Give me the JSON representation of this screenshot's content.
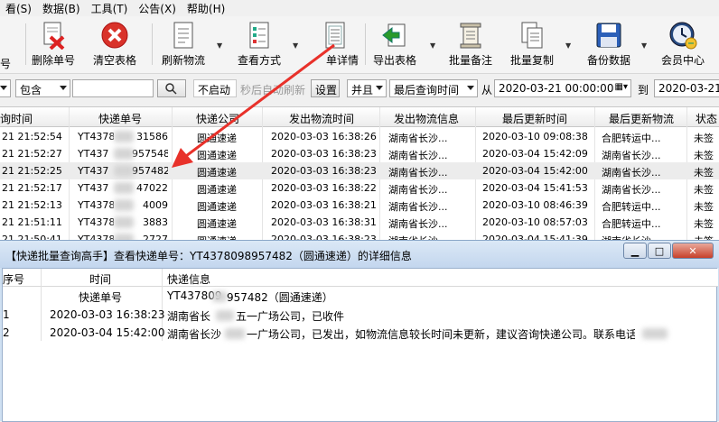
{
  "menu": [
    "看(S)",
    "数据(B)",
    "工具(T)",
    "公告(X)",
    "帮助(H)"
  ],
  "toolbar": {
    "partial_label": "号",
    "buttons": [
      {
        "label": "删除单号",
        "icon": "delete-doc-icon"
      },
      {
        "label": "清空表格",
        "icon": "clear-red-x-icon"
      },
      {
        "label": "刷新物流",
        "icon": "refresh-doc-icon"
      },
      {
        "label": "查看方式",
        "icon": "view-list-icon"
      },
      {
        "label": "单详情",
        "icon": "detail-doc-icon"
      },
      {
        "label": "导出表格",
        "icon": "export-green-arrow-icon"
      },
      {
        "label": "批量备注",
        "icon": "note-scroll-icon"
      },
      {
        "label": "批量复制",
        "icon": "copy-doc-icon"
      },
      {
        "label": "备份数据",
        "icon": "floppy-disk-icon"
      },
      {
        "label": "会员中心",
        "icon": "clock-user-icon"
      }
    ]
  },
  "filter": {
    "contains": "包含",
    "status_button": "不启动",
    "auto_refresh_text": "秒后自动刷新",
    "settings_button": "设置",
    "logic": "并且",
    "time_field": "最后查询时间",
    "from_label": "从",
    "from_value": "2020-03-21 00:00:00",
    "to_label": "到",
    "to_value": "2020-03-21 ..."
  },
  "table": {
    "headers": [
      "询时间",
      "快递单号",
      "快递公司",
      "发出物流时间",
      "发出物流信息",
      "最后更新时间",
      "最后更新物流",
      "状态"
    ],
    "rows": [
      [
        "21 21:52:54",
        "YT43780",
        "31586",
        "圆通速递",
        "2020-03-03 16:38:26",
        "湖南省长沙...",
        "2020-03-10 09:08:38",
        "合肥转运中...",
        "未签"
      ],
      [
        "21 21:52:27",
        "YT437",
        "957548",
        "圆通速递",
        "2020-03-03 16:38:23",
        "湖南省长沙...",
        "2020-03-04 15:42:09",
        "湖南省长沙...",
        "未签"
      ],
      [
        "21 21:52:25",
        "YT437",
        "957482",
        "圆通速递",
        "2020-03-03 16:38:23",
        "湖南省长沙...",
        "2020-03-04 15:42:00",
        "湖南省长沙...",
        "未签"
      ],
      [
        "21 21:52:17",
        "YT437",
        "47022",
        "圆通速递",
        "2020-03-03 16:38:22",
        "湖南省长沙...",
        "2020-03-04 15:41:53",
        "湖南省长沙...",
        "未签"
      ],
      [
        "21 21:52:13",
        "YT43781",
        "4009",
        "圆通速递",
        "2020-03-03 16:38:21",
        "湖南省长沙...",
        "2020-03-10 08:46:39",
        "合肥转运中...",
        "未签"
      ],
      [
        "21 21:51:11",
        "YT43780",
        "3883",
        "圆通速递",
        "2020-03-03 16:38:31",
        "湖南省长沙...",
        "2020-03-10 08:57:03",
        "合肥转运中...",
        "未签"
      ],
      [
        "21 21:50:41",
        "YT43780",
        "2727",
        "圆通速递",
        "2020-03-03 16:38:23",
        "湖南省长沙...",
        "2020-03-04 15:41:39",
        "湖南省长沙...",
        "未签"
      ]
    ]
  },
  "dialog": {
    "title": "【快递批量查询高手】查看快递单号：YT4378098957482（圆通速递）的详细信息",
    "headers": [
      "序号",
      "时间",
      "快递信息"
    ],
    "tracking_label": "快递单号",
    "tracking_value_a": "YT437809",
    "tracking_value_b": "957482（圆通速递）",
    "rows": [
      {
        "no": "1",
        "time": "2020-03-03 16:38:23",
        "info_a": "湖南省长",
        "info_b": "五一广场公司，已收件"
      },
      {
        "no": "2",
        "time": "2020-03-04 15:42:00",
        "info_a": "湖南省长沙",
        "info_b": "一广场公司，已发出，如物流信息较长时间未更新，建议咨询快递公司。联系电话："
      }
    ]
  },
  "colors": {
    "arrow": "#e8312a",
    "selected_row": "#ececec",
    "dialog_frame": "#cfe0f2"
  }
}
